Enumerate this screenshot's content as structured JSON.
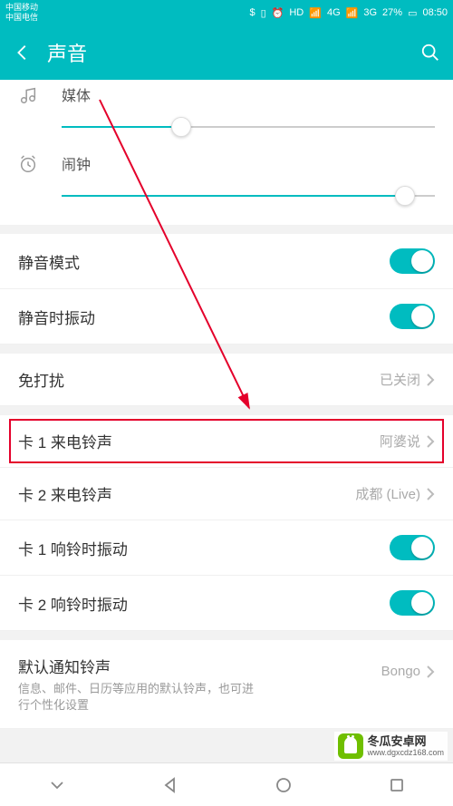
{
  "statusbar": {
    "carrier1": "中国移动",
    "carrier2": "中国电信",
    "battery": "27%",
    "time": "08:50"
  },
  "header": {
    "title": "声音"
  },
  "sliders": {
    "media": {
      "label": "媒体",
      "value_pct": 32
    },
    "alarm": {
      "label": "闹钟",
      "value_pct": 92
    }
  },
  "rows": {
    "silent_mode": {
      "label": "静音模式",
      "on": true
    },
    "vibrate_silent": {
      "label": "静音时振动",
      "on": true
    },
    "dnd": {
      "label": "免打扰",
      "value": "已关闭"
    },
    "sim1_ringtone": {
      "label": "卡 1 来电铃声",
      "value": "阿婆说"
    },
    "sim2_ringtone": {
      "label": "卡 2 来电铃声",
      "value": "成都 (Live)"
    },
    "sim1_vibrate": {
      "label": "卡 1 响铃时振动",
      "on": true
    },
    "sim2_vibrate": {
      "label": "卡 2 响铃时振动",
      "on": true
    },
    "default_notif": {
      "label": "默认通知铃声",
      "sub": "信息、邮件、日历等应用的默认铃声，也可进行个性化设置",
      "value": "Bongo"
    }
  },
  "watermark": {
    "name": "冬瓜安卓网",
    "url": "www.dgxcdz168.com"
  }
}
